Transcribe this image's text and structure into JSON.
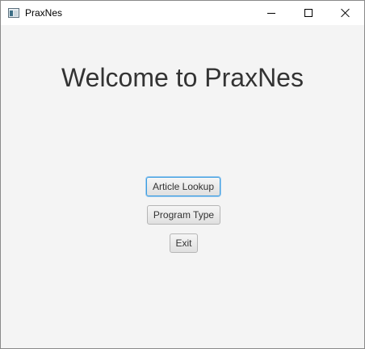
{
  "window": {
    "title": "PraxNes",
    "controls": {
      "minimize": "minimize",
      "maximize": "maximize",
      "close": "close"
    }
  },
  "main": {
    "heading": "Welcome to PraxNes",
    "buttons": {
      "article_lookup": "Article Lookup",
      "program_type": "Program Type",
      "exit": "Exit"
    }
  },
  "colors": {
    "background": "#f4f4f4",
    "titlebar": "#ffffff",
    "focus_ring": "#3c9de0",
    "text": "#333333"
  },
  "icons": {
    "app": "app-window-icon",
    "minimize": "minimize-icon",
    "maximize": "maximize-icon",
    "close": "close-icon"
  }
}
